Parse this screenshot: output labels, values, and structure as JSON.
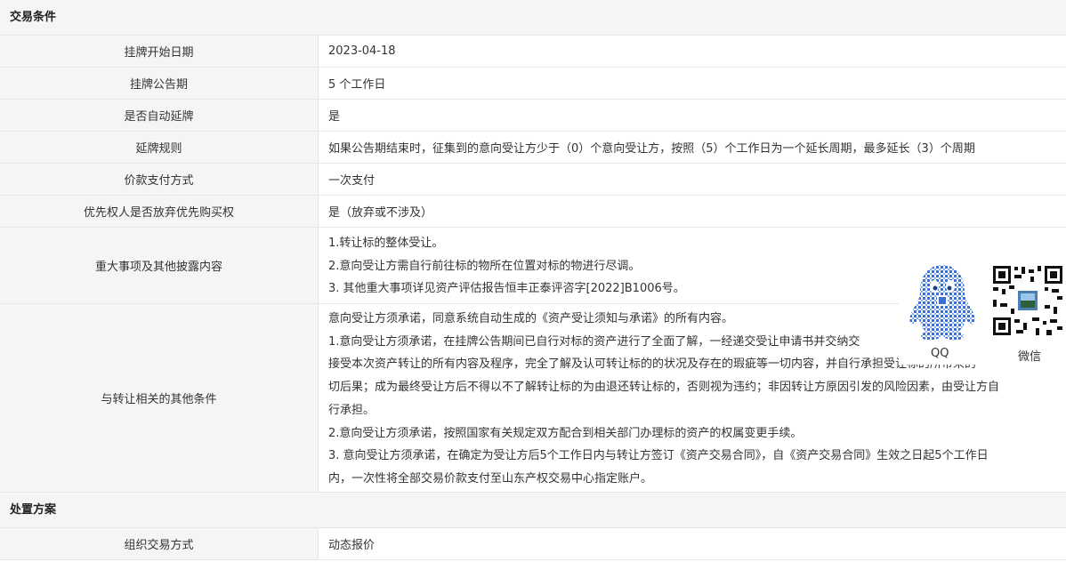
{
  "sections": {
    "trade": {
      "title": "交易条件"
    },
    "disposal": {
      "title": "处置方案"
    }
  },
  "rows": {
    "start_date": {
      "label": "挂牌开始日期",
      "value": "2023-04-18"
    },
    "notice_period": {
      "label": "挂牌公告期",
      "value": "5 个工作日"
    },
    "auto_extend": {
      "label": "是否自动延牌",
      "value": "是"
    },
    "extend_rule": {
      "label": "延牌规则",
      "value": "如果公告期结束时，征集到的意向受让方少于（0）个意向受让方，按照（5）个工作日为一个延长周期，最多延长（3）个周期"
    },
    "payment": {
      "label": "价款支付方式",
      "value": "一次支付"
    },
    "priority": {
      "label": "优先权人是否放弃优先购买权",
      "value": "是（放弃或不涉及）"
    },
    "disclosure": {
      "label": "重大事项及其他披露内容",
      "lines": [
        "1.转让标的整体受让。",
        "2.意向受让方需自行前往标的物所在位置对标的物进行尽调。",
        "3. 其他重大事项详见资产评估报告恒丰正泰评咨字[2022]B1006号。"
      ]
    },
    "other_conditions": {
      "label": "与转让相关的其他条件",
      "lines": [
        "意向受让方须承诺，同意系统自动生成的《资产受让须知与承诺》的所有内容。",
        "1.意向受让方须承诺，在挂牌公告期间已自行对标的资产进行了全面了解，一经递交受让申请书并交纳交",
        "接受本次资产转让的所有内容及程序，完全了解及认可转让标的的状况及存在的瑕疵等一切内容，并自行承担受让标的所带来的",
        "切后果；成为最终受让方后不得以不了解转让标的为由退还转让标的，否则视为违约；非因转让方原因引发的风险因素，由受让方自",
        "行承担。",
        "2.意向受让方须承诺，按照国家有关规定双方配合到相关部门办理标的资产的权属变更手续。",
        "3. 意向受让方须承诺，在确定为受让方后5个工作日内与转让方签订《资产交易合同》，自《资产交易合同》生效之日起5个工作日",
        "内，一次性将全部交易价款支付至山东产权交易中心指定账户。"
      ]
    },
    "trade_method": {
      "label": "组织交易方式",
      "value": "动态报价"
    }
  },
  "qr": {
    "qq_caption": "QQ",
    "wechat_caption": "微信",
    "qq_icon": "qq-penguin-qr-icon",
    "wechat_icon": "wechat-qr-icon"
  },
  "colors": {
    "label_bg": "#f5f5f5",
    "border": "#e6e6e6",
    "qr_blue": "#3b6fd8"
  }
}
